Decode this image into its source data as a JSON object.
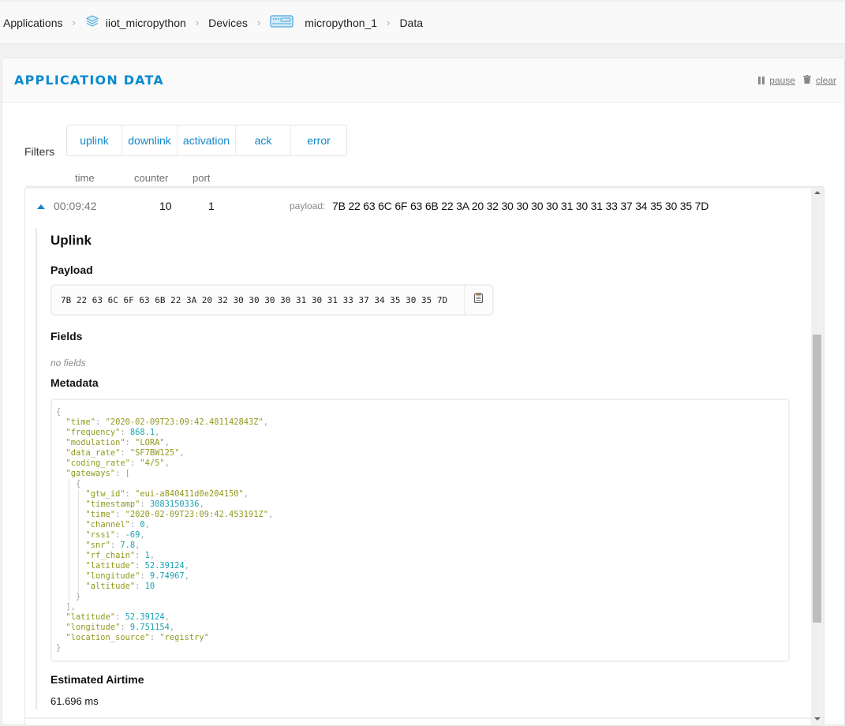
{
  "breadcrumb": {
    "items": [
      {
        "label": "Applications",
        "icon": null
      },
      {
        "label": "iiot_micropython",
        "icon": "layers-icon"
      },
      {
        "label": "Devices",
        "icon": null
      },
      {
        "label": "micropython_1",
        "icon": "device-icon"
      },
      {
        "label": "Data",
        "icon": null
      }
    ],
    "separator": "›"
  },
  "panel": {
    "title": "APPLICATION DATA",
    "actions": {
      "pause_label": "pause",
      "clear_label": "clear"
    }
  },
  "filters": {
    "label": "Filters",
    "options": [
      "uplink",
      "downlink",
      "activation",
      "ack",
      "error"
    ]
  },
  "columns": {
    "time": "time",
    "counter": "counter",
    "port": "port"
  },
  "event": {
    "time": "00:09:42",
    "counter": "10",
    "port": "1",
    "payload_label": "payload:",
    "payload": "7B 22 63 6C 6F 63 6B 22 3A 20 32 30 30 30 30 31 30 31 33 37 34 35 30 35 7D",
    "detail": {
      "title": "Uplink",
      "payload_heading": "Payload",
      "payload_hex": "7B 22 63 6C 6F 63 6B 22 3A 20 32 30 30 30 30 31 30 31 33 37 34 35 30 35 7D",
      "fields_heading": "Fields",
      "fields_empty": "no fields",
      "metadata_heading": "Metadata",
      "metadata": {
        "time": "2020-02-09T23:09:42.481142843Z",
        "frequency": 868.1,
        "modulation": "LORA",
        "data_rate": "SF7BW125",
        "coding_rate": "4/5",
        "gateways": [
          {
            "gtw_id": "eui-a840411d0e204150",
            "timestamp": 3083150336,
            "time": "2020-02-09T23:09:42.453191Z",
            "channel": 0,
            "rssi": -69,
            "snr": 7.8,
            "rf_chain": 1,
            "latitude": 52.39124,
            "longitude": 9.74967,
            "altitude": 10
          }
        ],
        "latitude": 52.39124,
        "longitude": 9.751154,
        "location_source": "registry"
      },
      "airtime_heading": "Estimated Airtime",
      "airtime_value": "61.696 ms"
    }
  },
  "colors": {
    "accent": "#0a8ad1",
    "link": "#1587c7",
    "json_key": "#909a1d",
    "json_number": "#17a3b2"
  }
}
